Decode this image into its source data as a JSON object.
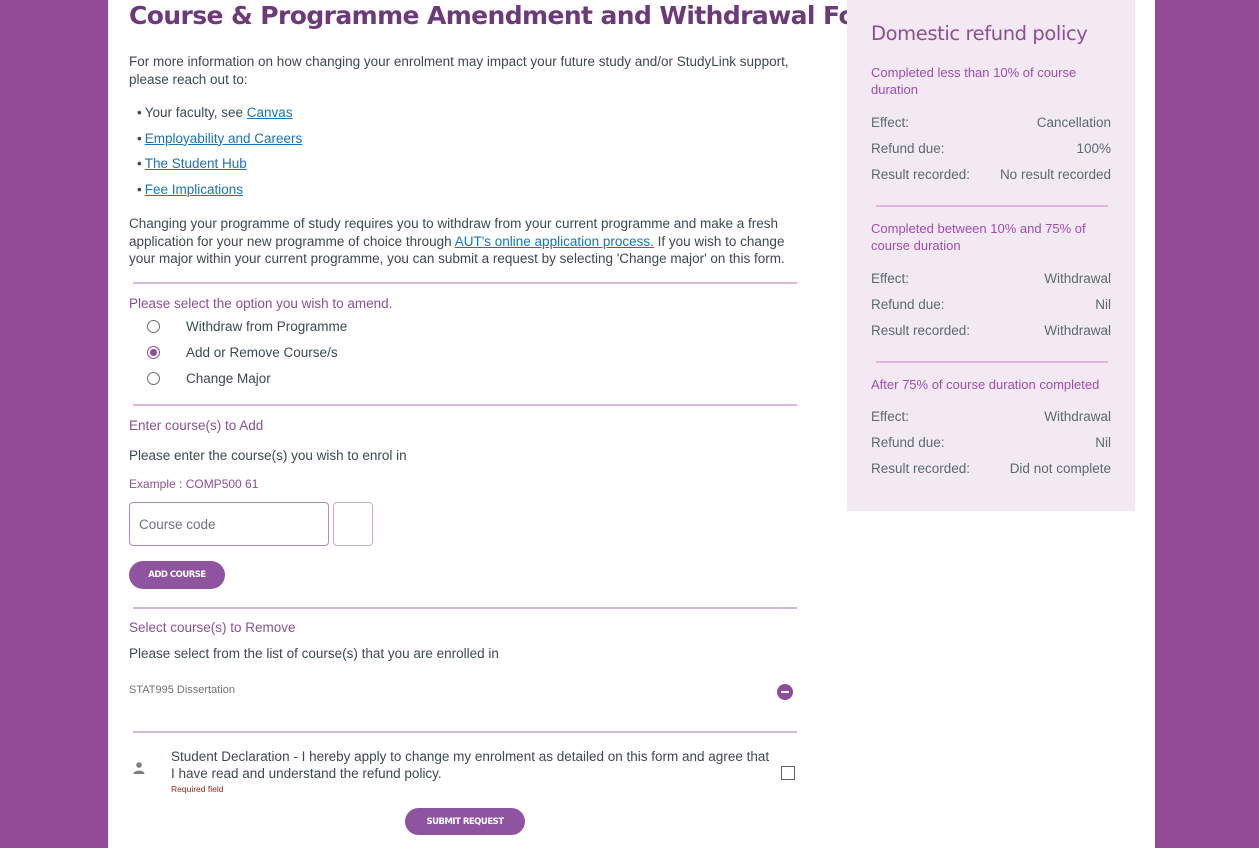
{
  "form": {
    "title": "Course & Programme Amendment and Withdrawal Form",
    "intro": "For more information on how changing your enrolment may impact your future study and/or StudyLink support, please reach out to:",
    "contacts": [
      {
        "prefix": "Your faculty, see ",
        "link": "Canvas"
      },
      {
        "prefix": "",
        "link": "Employability and Careers"
      },
      {
        "prefix": "",
        "link": "The Student Hub"
      },
      {
        "prefix": "",
        "link": "Fee Implications"
      }
    ],
    "bullet": "•",
    "change_para": {
      "before": "Changing your programme of study requires you to withdraw from your current programme and make a fresh application for your new programme of choice through ",
      "link": "AUT's online application process.",
      "after": " If you wish to change your major within your current programme, you can submit a request by selecting 'Change major' on this form."
    },
    "amend_label": "Please select the option you wish to amend.",
    "amend_options": [
      {
        "label": "Withdraw from Programme",
        "checked": false
      },
      {
        "label": "Add or Remove Course/s",
        "checked": true
      },
      {
        "label": "Change Major",
        "checked": false
      }
    ],
    "add_section": {
      "label": "Enter course(s) to Add",
      "instruction": "Please enter the course(s) you wish to enrol in",
      "example": "Example : COMP500 61",
      "input_placeholder": "Course code",
      "input_value": "",
      "button": "ADD COURSE"
    },
    "remove_section": {
      "label": "Select course(s) to Remove",
      "instruction": "Please select from the list of course(s) that you are enrolled in",
      "courses": [
        "STAT995 Dissertation"
      ]
    },
    "declaration": {
      "text": "Student Declaration - I hereby apply to change my enrolment as detailed on this form and agree that I have read and understand the refund policy.",
      "required": "Required field",
      "checked": false
    },
    "submit": "SUBMIT REQUEST"
  },
  "sidebar": {
    "title": "Domestic refund policy",
    "sections": [
      {
        "heading": "Completed less than 10% of course duration",
        "rows": [
          {
            "label": "Effect:",
            "value": "Cancellation"
          },
          {
            "label": "Refund due:",
            "value": "100%"
          },
          {
            "label": "Result recorded:",
            "value": "No result recorded"
          }
        ]
      },
      {
        "heading": "Completed between 10% and 75% of course duration",
        "rows": [
          {
            "label": "Effect:",
            "value": "Withdrawal"
          },
          {
            "label": "Refund due:",
            "value": "Nil"
          },
          {
            "label": "Result recorded:",
            "value": "Withdrawal"
          }
        ]
      },
      {
        "heading": "After 75% of course duration completed",
        "rows": [
          {
            "label": "Effect:",
            "value": "Withdrawal"
          },
          {
            "label": "Refund due:",
            "value": "Nil"
          },
          {
            "label": "Result recorded:",
            "value": "Did not complete"
          }
        ]
      }
    ]
  },
  "colors": {
    "background": "#944b97",
    "brand_purple": "#8e4d98",
    "title_purple": "#6c3a7a",
    "link_blue": "#1a72b9",
    "sidebar_bg": "#f2e9f3",
    "required_red": "#a32020"
  }
}
